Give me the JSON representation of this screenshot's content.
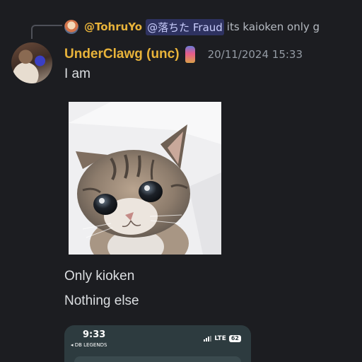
{
  "reply": {
    "author": "@TohruYo",
    "mention": "@落ちた Fraud",
    "text": "its kaioken only g"
  },
  "message": {
    "username": "UnderClawg (unc)",
    "timestamp": "20/11/2024 15:33",
    "lines": [
      "I am",
      "Only kioken",
      "Nothing else"
    ]
  },
  "embedded_screenshot": {
    "time": "9:33",
    "back_label": "◂ DB LEGENDS",
    "network": "LTE",
    "battery": "62"
  },
  "colors": {
    "background": "#1c1d21",
    "username": "#e8b33a",
    "text": "#dbdee1",
    "timestamp": "#949ba4",
    "mention_bg": "#5865f2"
  }
}
